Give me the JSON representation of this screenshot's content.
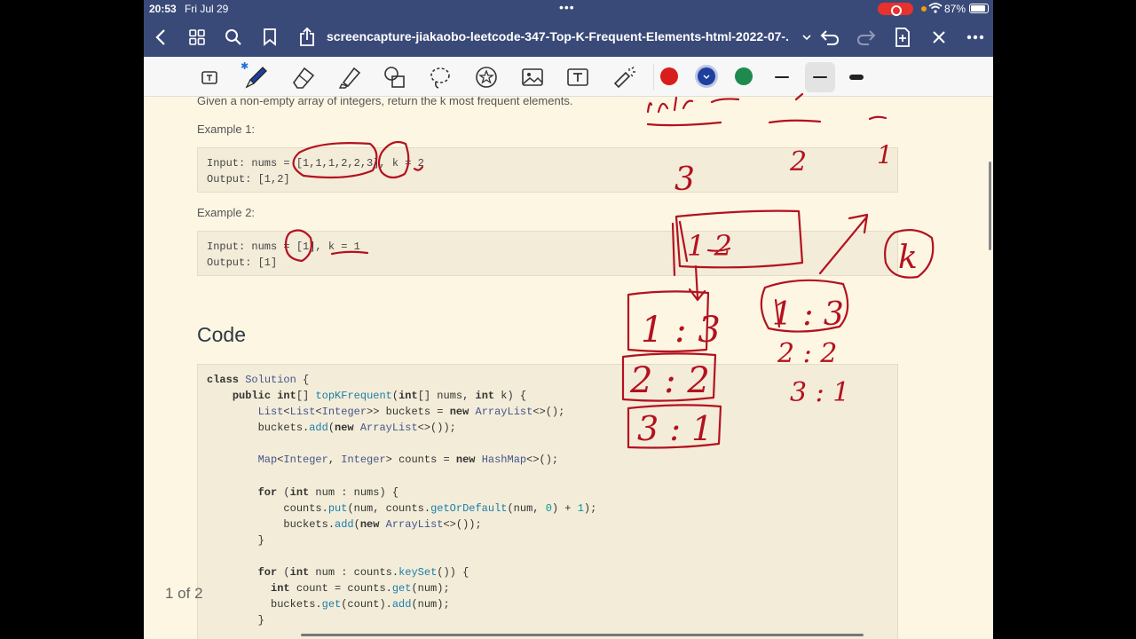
{
  "status": {
    "time": "20:53",
    "date": "Fri Jul 29",
    "battery": "87%",
    "battery_level": 0.87
  },
  "nav": {
    "title": "screencapture-jiakaobo-leetcode-347-Top-K-Frequent-Elements-html-2022-07-..."
  },
  "toolbar": {
    "colors": [
      "#d91c1c",
      "#1e3f9e",
      "#1e8a4e"
    ],
    "selected_color": "#1e3f9e",
    "icons": [
      "text-select-icon",
      "pen-icon",
      "eraser-icon",
      "highlighter-icon",
      "shapes-icon",
      "lasso-icon",
      "sticker-icon",
      "image-icon",
      "text-box-icon",
      "laser-pointer-icon"
    ]
  },
  "doc": {
    "intro": "Given a non-empty array of integers, return the k most frequent elements.",
    "example1_label": "Example 1:",
    "example1_input": "Input: nums = [1,1,1,2,2,3], k = 2",
    "example1_output": "Output: [1,2]",
    "example2_label": "Example 2:",
    "example2_input": "Input: nums = [1], k = 1",
    "example2_output": "Output: [1]",
    "code_heading": "Code",
    "page_indicator": "1 of 2"
  },
  "code_lines": [
    "class Solution {",
    "    public int[] topKFrequent(int[] nums, int k) {",
    "        List<List<Integer>> buckets = new ArrayList<>();",
    "        buckets.add(new ArrayList<>());",
    "",
    "        Map<Integer, Integer> counts = new HashMap<>();",
    "",
    "        for (int num : nums) {",
    "            counts.put(num, counts.getOrDefault(num, 0) + 1);",
    "            buckets.add(new ArrayList<>());",
    "        }",
    "",
    "        for (int num : counts.keySet()) {",
    "          int count = counts.get(num);",
    "          buckets.get(count).add(num);",
    "        }"
  ],
  "ink_color": "#b3121f",
  "annotations": {
    "top_numbers": [
      "3",
      "2",
      "1"
    ],
    "bucket_box_1": "1 : 3",
    "bucket_box_2": "2 : 2",
    "bucket_box_3": "3 : 1",
    "map_1": "1 : 3",
    "map_2": "2 : 2",
    "map_3": "3 : 1",
    "top_box": "1  2",
    "k_circle": "k"
  }
}
